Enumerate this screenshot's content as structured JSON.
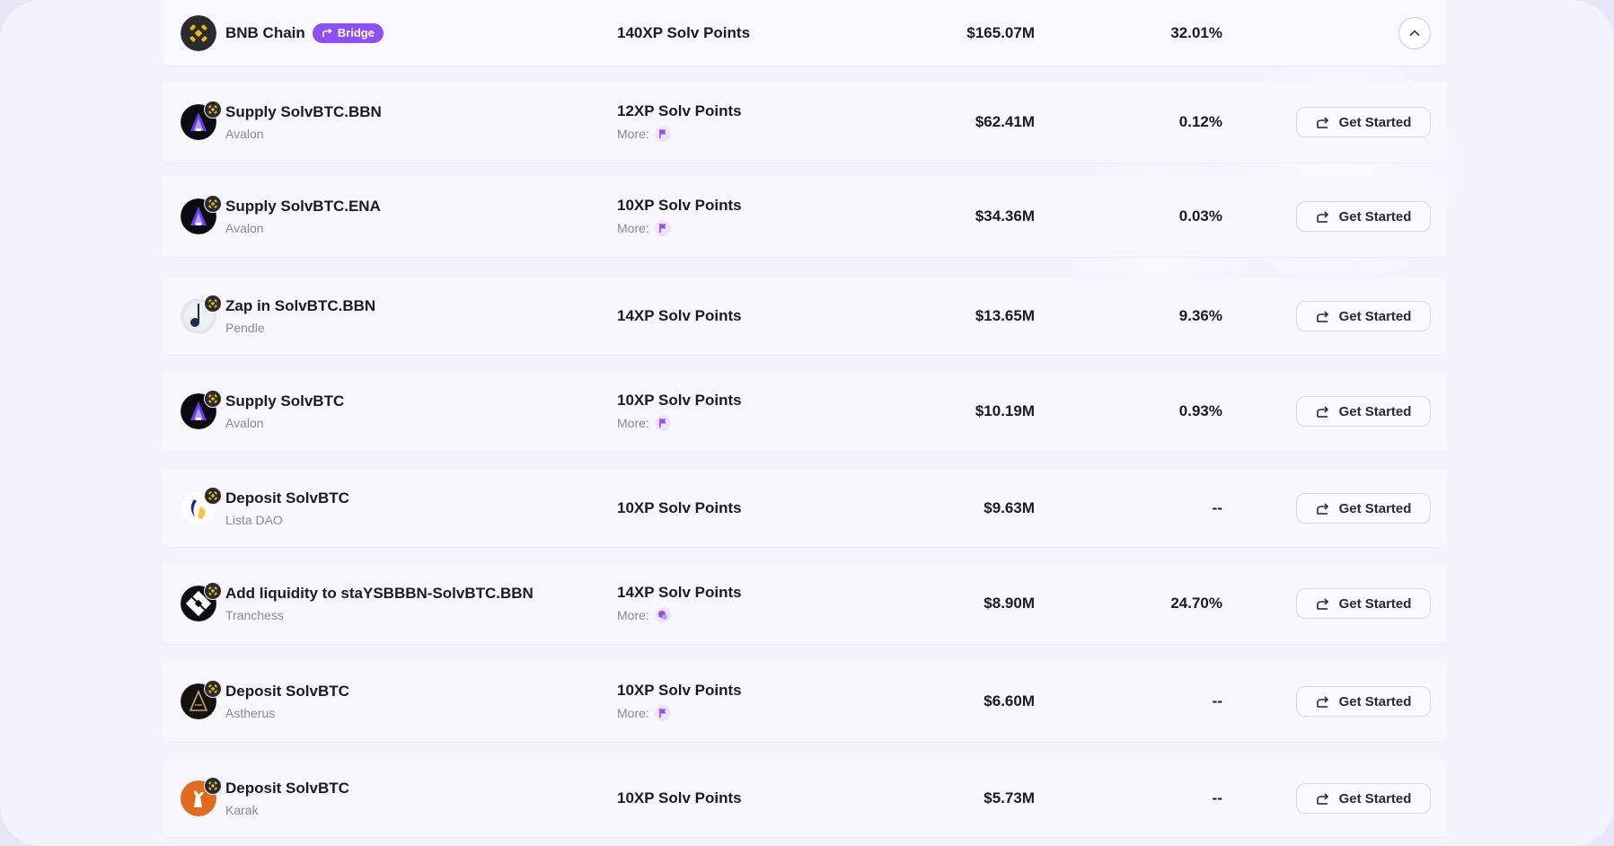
{
  "chain": {
    "name": "BNB Chain",
    "bridge_label": "Bridge",
    "points": "140XP Solv Points",
    "tvl": "$165.07M",
    "apy": "32.01%"
  },
  "more_label": "More:",
  "action_label": "Get Started",
  "rows": [
    {
      "title": "Supply SolvBTC.BBN",
      "protocol": "Avalon",
      "points": "12XP Solv Points",
      "more": true,
      "more_icon": "flag-icon",
      "tvl": "$62.41M",
      "apy": "0.12%"
    },
    {
      "title": "Supply SolvBTC.ENA",
      "protocol": "Avalon",
      "points": "10XP Solv Points",
      "more": true,
      "more_icon": "flag-icon",
      "tvl": "$34.36M",
      "apy": "0.03%"
    },
    {
      "title": "Zap in SolvBTC.BBN",
      "protocol": "Pendle",
      "points": "14XP Solv Points",
      "more": false,
      "tvl": "$13.65M",
      "apy": "9.36%"
    },
    {
      "title": "Supply SolvBTC",
      "protocol": "Avalon",
      "points": "10XP Solv Points",
      "more": true,
      "more_icon": "flag-icon",
      "tvl": "$10.19M",
      "apy": "0.93%"
    },
    {
      "title": "Deposit SolvBTC",
      "protocol": "Lista DAO",
      "points": "10XP Solv Points",
      "more": false,
      "tvl": "$9.63M",
      "apy": "--"
    },
    {
      "title": "Add liquidity to staYSBBBN-SolvBTC.BBN",
      "protocol": "Tranchess",
      "points": "14XP Solv Points",
      "more": true,
      "more_icon": "coin-icon",
      "tvl": "$8.90M",
      "apy": "24.70%"
    },
    {
      "title": "Deposit SolvBTC",
      "protocol": "Astherus",
      "points": "10XP Solv Points",
      "more": true,
      "more_icon": "flag-icon",
      "tvl": "$6.60M",
      "apy": "--"
    },
    {
      "title": "Deposit SolvBTC",
      "protocol": "Karak",
      "points": "10XP Solv Points",
      "more": false,
      "tvl": "$5.73M",
      "apy": "--"
    }
  ],
  "colors": {
    "accent": "#8e4ff4",
    "bnb_yellow": "#f0b90b",
    "background": "#f4f2fc"
  }
}
